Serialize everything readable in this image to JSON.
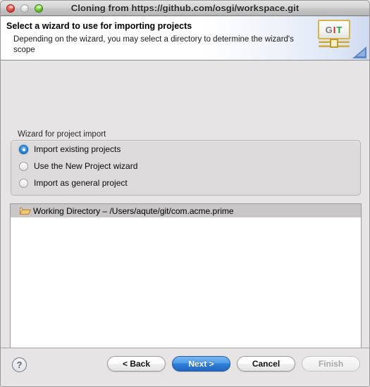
{
  "window": {
    "title": "Cloning from https://github.com/osgi/workspace.git",
    "traffic_lights": [
      {
        "name": "close",
        "label": "Close"
      },
      {
        "name": "minimize",
        "label": "Minimize"
      },
      {
        "name": "zoom",
        "label": "Zoom"
      }
    ]
  },
  "banner": {
    "title": "Select a wizard to use for importing projects",
    "description": "Depending on the wizard, you may select a directory to determine the wizard's scope",
    "logo": {
      "icon": "git-logo-icon",
      "letter_g": "G",
      "letter_i": "I",
      "letter_t": "T"
    }
  },
  "group": {
    "label": "Wizard for project import",
    "options": [
      {
        "label": "Import existing projects",
        "selected": true
      },
      {
        "label": "Use the New Project wizard",
        "selected": false
      },
      {
        "label": "Import as general project",
        "selected": false
      }
    ]
  },
  "tree": {
    "rows": [
      {
        "icon": "open-folder-icon",
        "label": "Working Directory – /Users/aqute/git/com.acme.prime",
        "selected": true
      }
    ]
  },
  "footer": {
    "help_label": "?",
    "buttons": [
      {
        "name": "back",
        "label": "< Back",
        "state": "normal"
      },
      {
        "name": "next",
        "label": "Next >",
        "state": "default"
      },
      {
        "name": "cancel",
        "label": "Cancel",
        "state": "normal"
      },
      {
        "name": "finish",
        "label": "Finish",
        "state": "disabled"
      }
    ]
  },
  "colors": {
    "accent_blue": "#2f7fd8",
    "window_bg": "#e6e4e4",
    "group_bg": "#dddbdb",
    "tree_bg": "#ffffff",
    "selection_gray": "#c9c7c7",
    "folder_gold": "#d9a441",
    "git_red": "#cf2222",
    "git_green": "#29a03f"
  }
}
